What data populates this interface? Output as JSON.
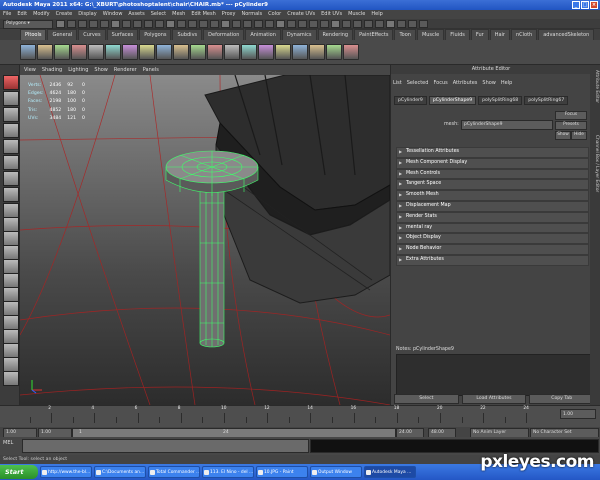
{
  "window": {
    "title": "Autodesk Maya 2011 x64: G:\\_XBURT\\photoshoptalent\\chair\\CHAIR.mb* --- pCylinder9"
  },
  "menubar": [
    "File",
    "Edit",
    "Modify",
    "Create",
    "Display",
    "Window",
    "Assets",
    "Select",
    "Mesh",
    "Edit Mesh",
    "Proxy",
    "Normals",
    "Color",
    "Create UVs",
    "Edit UVs",
    "Muscle",
    "Help"
  ],
  "status_line": {
    "mode": "Polygons"
  },
  "shelf_tabs": [
    "Pltools",
    "General",
    "Curves",
    "Surfaces",
    "Polygons",
    "Subdivs",
    "Deformation",
    "Animation",
    "Dynamics",
    "Rendering",
    "PaintEffects",
    "Toon",
    "Muscle",
    "Fluids",
    "Fur",
    "Hair",
    "nCloth",
    "advancedSkeleton"
  ],
  "shelf_active_tab": "Pltools",
  "viewport": {
    "menu": [
      "View",
      "Shading",
      "Lighting",
      "Show",
      "Renderer",
      "Panels"
    ],
    "hud": [
      {
        "label": "Verts:",
        "a": "2436",
        "b": "92",
        "c": "0"
      },
      {
        "label": "Edges:",
        "a": "4624",
        "b": "180",
        "c": "0"
      },
      {
        "label": "Faces:",
        "a": "2198",
        "b": "100",
        "c": "0"
      },
      {
        "label": "Tris:",
        "a": "4852",
        "b": "180",
        "c": "0"
      },
      {
        "label": "UVs:",
        "a": "3484",
        "b": "121",
        "c": "0"
      }
    ]
  },
  "attribute_editor": {
    "title": "Attribute Editor",
    "menu": [
      "List",
      "Selected",
      "Focus",
      "Attributes",
      "Show",
      "Help"
    ],
    "tabs": [
      "pCylinder9",
      "pCylinderShape9",
      "polySplitRing68",
      "polySplitRing67"
    ],
    "active_tab": "pCylinderShape9",
    "mesh_label": "mesh:",
    "mesh_value": "pCylinderShape9",
    "buttons": [
      "Focus",
      "Presets",
      "Show",
      "Hide"
    ],
    "sections": [
      "Tessellation Attributes",
      "Mesh Component Display",
      "Mesh Controls",
      "Tangent Space",
      "Smooth Mesh",
      "Displacement Map",
      "Render Stats",
      "mental ray",
      "Object Display",
      "Node Behavior",
      "Extra Attributes"
    ],
    "notes_label": "Notes: pCylinderShape9",
    "bottom_buttons": [
      "Select",
      "Load Attributes",
      "Copy Tab"
    ],
    "side_tabs": [
      "Attribute Editor",
      "Channel Box / Layer Editor"
    ]
  },
  "time_slider": {
    "ticks": [
      "2",
      "4",
      "6",
      "8",
      "10",
      "12",
      "14",
      "16",
      "18",
      "20",
      "22",
      "24"
    ],
    "current_frame": "1.00"
  },
  "range_slider": {
    "start": "1.00",
    "inner_start": "1.00",
    "inner_value": "1",
    "inner_end": "24",
    "end_a": "24.00",
    "end_b": "48.00",
    "anim_layer": "No Anim Layer",
    "character_set": "No Character Set"
  },
  "command_line": {
    "label": "MEL"
  },
  "help_line": "Select Tool: select an object",
  "taskbar": {
    "start_label": "Start",
    "tasks": [
      "http://www.the-bl...",
      "C:\\Documents an...",
      "Total Commander ...",
      "113. El Nino - del ...",
      "10.JPG - Paint",
      "Output Window",
      "Autodesk Maya ..."
    ],
    "active_task": 6
  },
  "watermark": "pxleyes.com",
  "colors": {
    "titlebar": "#2459c8",
    "viewport_grid": "#b02020",
    "wireframe": "#3fff6a",
    "hud_label": "#b5f0ff"
  }
}
